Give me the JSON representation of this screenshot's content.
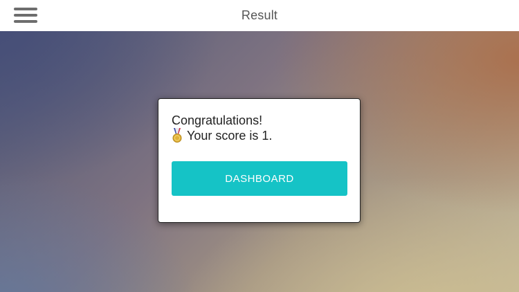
{
  "header": {
    "title": "Result",
    "menu_icon": "hamburger-menu-icon"
  },
  "dialog": {
    "heading": "Congratulations!",
    "score_text": "Your score is 1.",
    "medal_icon": "medal-icon",
    "button_label": "DASHBOARD"
  },
  "colors": {
    "accent": "#15c3c6",
    "header_bg": "#ffffff",
    "title_text": "#555555"
  }
}
